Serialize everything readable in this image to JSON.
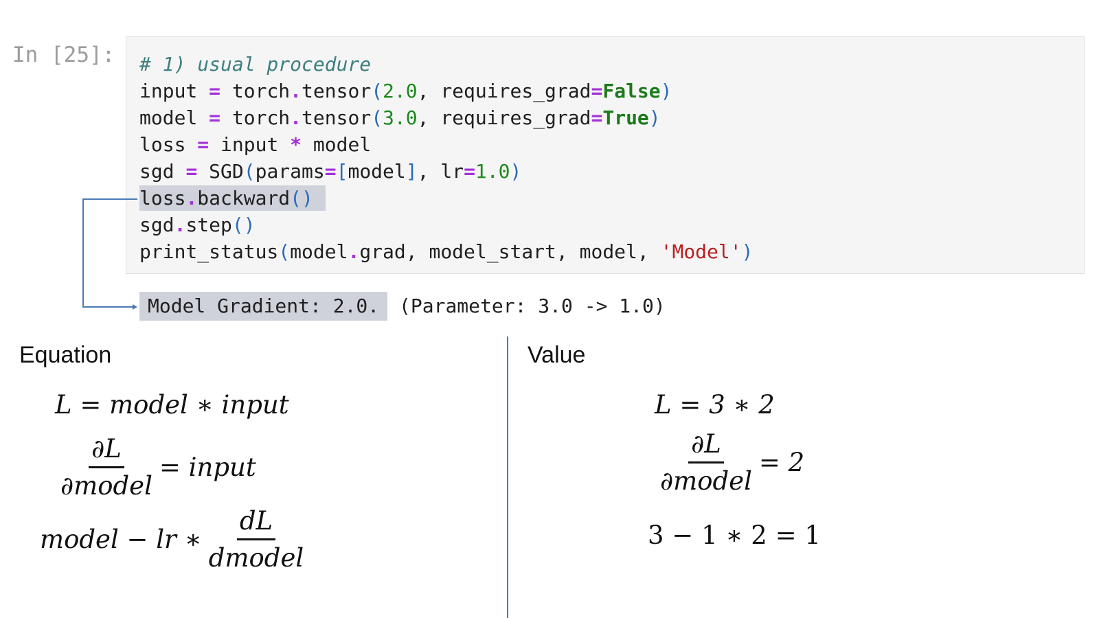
{
  "cell": {
    "prompt": "In [25]:",
    "code": {
      "line1": "# 1) usual procedure",
      "line2": [
        "input ",
        "=",
        " torch",
        ".",
        "tensor",
        "(",
        "2.0",
        ", requires_grad",
        "=",
        "False",
        ")"
      ],
      "line3": [
        "model ",
        "=",
        " torch",
        ".",
        "tensor",
        "(",
        "3.0",
        ", requires_grad",
        "=",
        "True",
        ")"
      ],
      "line4": [
        "loss ",
        "=",
        " input ",
        "*",
        " model"
      ],
      "line5": [
        "sgd ",
        "=",
        " SGD",
        "(",
        "params",
        "=",
        "[",
        "model",
        "]",
        ", lr",
        "=",
        "1.0",
        ")"
      ],
      "line6": [
        "loss",
        ".",
        "backward",
        "()"
      ],
      "line7": [
        "sgd",
        ".",
        "step",
        "()"
      ],
      "line8": [
        "print_status",
        "(",
        "model",
        ".",
        "grad, model_start, model, ",
        "'Model'",
        ")"
      ]
    }
  },
  "output": {
    "highlighted": "Model Gradient: 2.0.",
    "rest": " (Parameter: 3.0 -> 1.0)"
  },
  "equation": {
    "title": "Equation",
    "eq1": "L = model ∗ input",
    "eq2_num": "∂L",
    "eq2_den": "∂model",
    "eq2_rhs": "= input",
    "eq3_lhs": "model − lr ∗",
    "eq3_num": "dL",
    "eq3_den": "dmodel"
  },
  "value": {
    "title": "Value",
    "v1": "L = 3 ∗ 2",
    "v2_num": "∂L",
    "v2_den": "∂model",
    "v2_rhs": "= 2",
    "v3": "3 − 1 ∗ 2 = 1"
  },
  "colors": {
    "comment": "#3f7f7f",
    "operator": "#a630d9",
    "number": "#1d8a1d",
    "keyword": "#1d7a1d",
    "punct": "#2b6bb8",
    "string": "#b82020",
    "highlight": "#cfd2db",
    "connector": "#4a7ab5"
  }
}
